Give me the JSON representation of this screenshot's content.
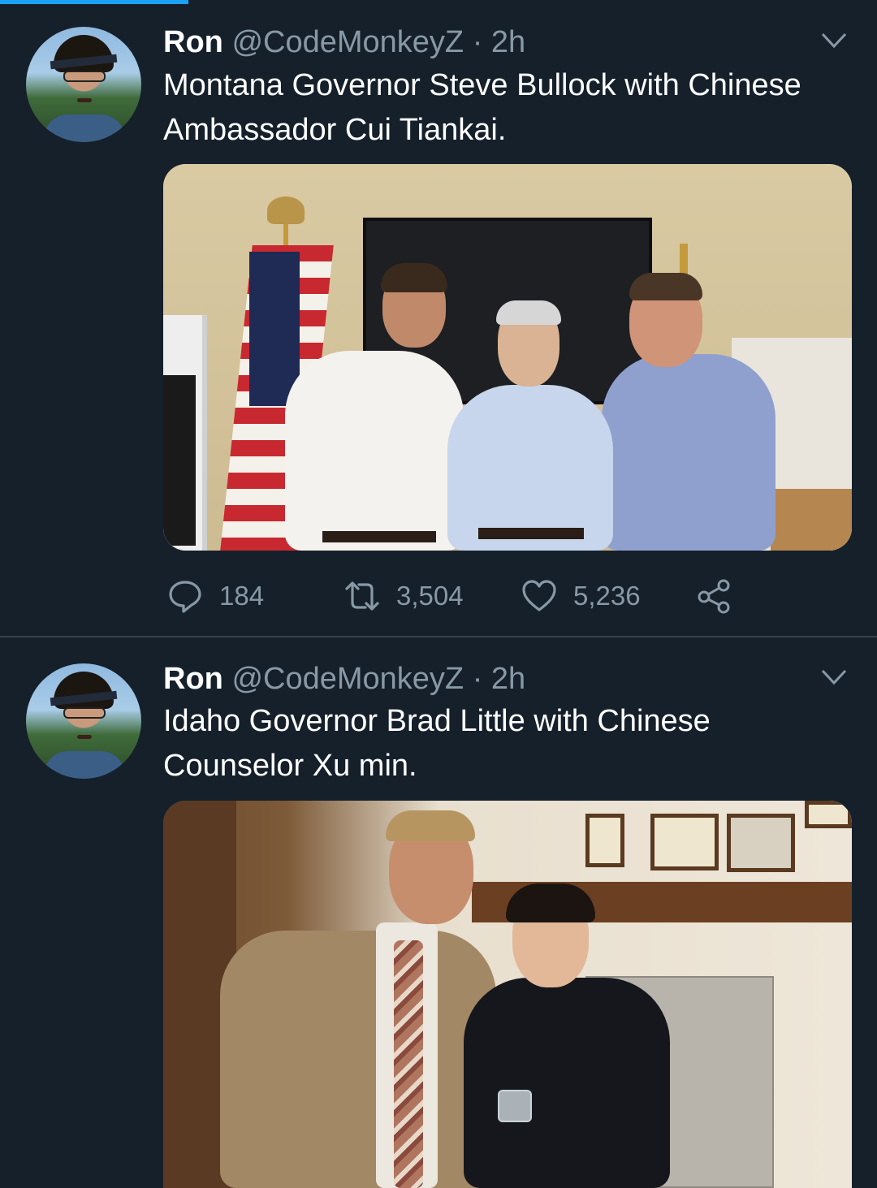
{
  "timeline": {
    "tweets": [
      {
        "author_name": "Ron",
        "handle": "@CodeMonkeyZ",
        "separator": "·",
        "time": "2h",
        "text": "Montana Governor Steve Bullock with Chinese Ambassador Cui Tiankai.",
        "actions": {
          "replies": "184",
          "retweets": "3,504",
          "likes": "5,236"
        }
      },
      {
        "author_name": "Ron",
        "handle": "@CodeMonkeyZ",
        "separator": "·",
        "time": "2h",
        "text": "Idaho Governor Brad Little with Chinese Counselor Xu min."
      }
    ]
  },
  "colors": {
    "background": "#15202b",
    "secondary_text": "#8899a6",
    "accent": "#1da1f2",
    "divider": "#38444d"
  },
  "icons": {
    "reply": "reply-icon",
    "retweet": "retweet-icon",
    "like": "heart-icon",
    "share": "share-icon",
    "menu": "chevron-down-icon"
  },
  "progress": {
    "loaded_fraction": 0.21
  }
}
